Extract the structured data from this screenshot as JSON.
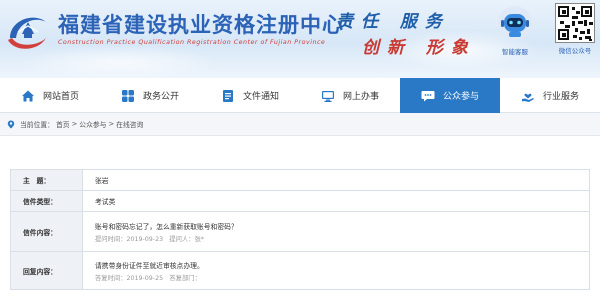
{
  "header": {
    "title": "福建省建设执业资格注册中心",
    "subtitle": "Construction Practice Qualification Registration Center of Fujian Province",
    "slogan_line1": "责任 服务",
    "slogan_line2": "创新 形象",
    "service_label": "智能客服",
    "wechat_label": "微信公众号"
  },
  "nav": {
    "items": [
      {
        "label": "网站首页",
        "icon": "home-icon"
      },
      {
        "label": "政务公开",
        "icon": "grid-icon"
      },
      {
        "label": "文件通知",
        "icon": "document-icon"
      },
      {
        "label": "网上办事",
        "icon": "monitor-icon"
      },
      {
        "label": "公众参与",
        "icon": "chat-icon",
        "active": true
      },
      {
        "label": "行业服务",
        "icon": "hand-icon"
      }
    ],
    "active_color": "#2a79c7"
  },
  "breadcrumb": {
    "prefix": "当前位置：",
    "items": [
      "首页",
      "公众参与",
      "在线咨询"
    ],
    "separator": ">"
  },
  "detail": {
    "subject_label": "主　题：",
    "subject_value": "张岩",
    "type_label": "信件类型：",
    "type_value": "考试类",
    "content_label": "信件内容：",
    "content_value": "账号和密码忘记了，怎么重新获取账号和密码？",
    "content_meta": "提问时间：2019-09-23　提问人：张*",
    "reply_label": "回复内容：",
    "reply_value": "请携带身份证件至就近审核点办理。",
    "reply_meta": "答复时间：2019-09-25　答复部门："
  }
}
